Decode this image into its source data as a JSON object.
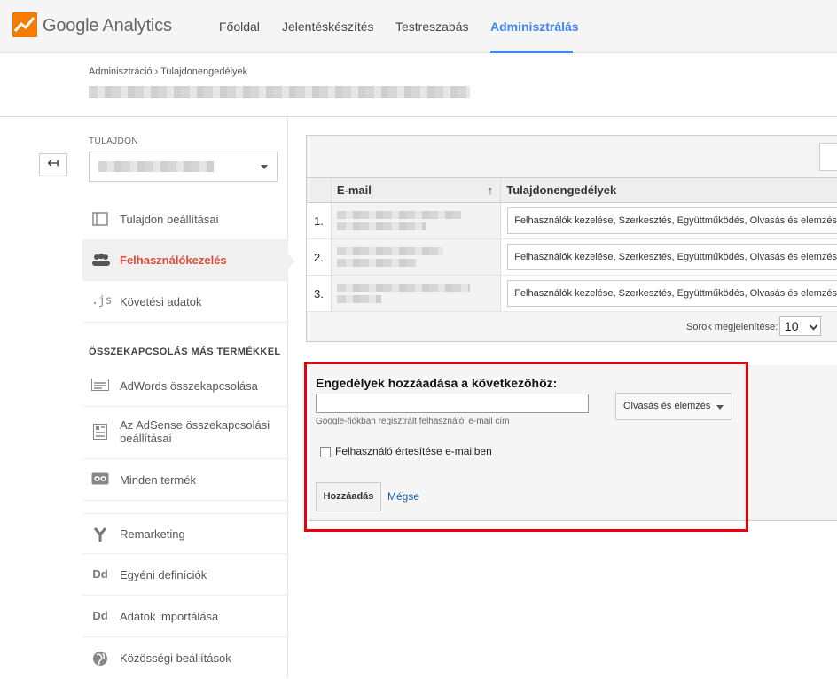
{
  "topbar": {
    "brand": "Google Analytics",
    "nav": [
      "Főoldal",
      "Jelentéskészítés",
      "Testreszabás",
      "Adminisztrálás"
    ],
    "active_nav": "Adminisztrálás"
  },
  "breadcrumb": "Adminisztráció › Tulajdonengedélyek",
  "sidebar": {
    "property_label": "TULAJDON",
    "items": [
      {
        "label": "Tulajdon beállításai",
        "icon": "window-icon"
      },
      {
        "label": "Felhasználókezelés",
        "icon": "users-icon"
      },
      {
        "label": "Követési adatok",
        "icon": "js-icon"
      }
    ],
    "connect_label": "ÖSSZEKAPCSOLÁS MÁS TERMÉKKEL",
    "connect_items": [
      {
        "label": "AdWords összekapcsolása",
        "icon": "adwords-icon"
      },
      {
        "label": "Az AdSense összekapcsolási beállításai",
        "icon": "adsense-icon"
      },
      {
        "label": "Minden termék",
        "icon": "link-icon"
      }
    ],
    "other_items": [
      {
        "label": "Remarketing",
        "icon": "remarketing-icon"
      },
      {
        "label": "Egyéni definíciók",
        "icon": "dd-icon",
        "glyph": "Dd"
      },
      {
        "label": "Adatok importálása",
        "icon": "dd-icon",
        "glyph": "Dd"
      },
      {
        "label": "Közösségi beállítások",
        "icon": "globe-icon"
      }
    ]
  },
  "users_table": {
    "columns": {
      "email": "E-mail",
      "permissions": "Tulajdonengedélyek"
    },
    "rows": [
      {
        "num": "1.",
        "permissions": "Felhasználók kezelése, Szerkesztés, Együttműködés, Olvasás és elemzés"
      },
      {
        "num": "2.",
        "permissions": "Felhasználók kezelése, Szerkesztés, Együttműködés, Olvasás és elemzés"
      },
      {
        "num": "3.",
        "permissions": "Felhasználók kezelése, Szerkesztés, Együttműködés, Olvasás és elemzés"
      }
    ],
    "rows_label": "Sorok megjelenítése:",
    "rows_value": "10"
  },
  "add_form": {
    "title": "Engedélyek hozzáadása a következőhöz:",
    "email_hint": "Google-fiókban regisztrált felhasználói e-mail cím",
    "permission_value": "Olvasás és elemzés",
    "notify_label": "Felhasználó értesítése e-mailben",
    "add_label": "Hozzáadás",
    "cancel_label": "Mégse"
  },
  "colors": {
    "accent": "#4285f4",
    "active_item": "#dd4b39",
    "highlight_frame": "#e8000b",
    "link": "#1a5ea8"
  }
}
